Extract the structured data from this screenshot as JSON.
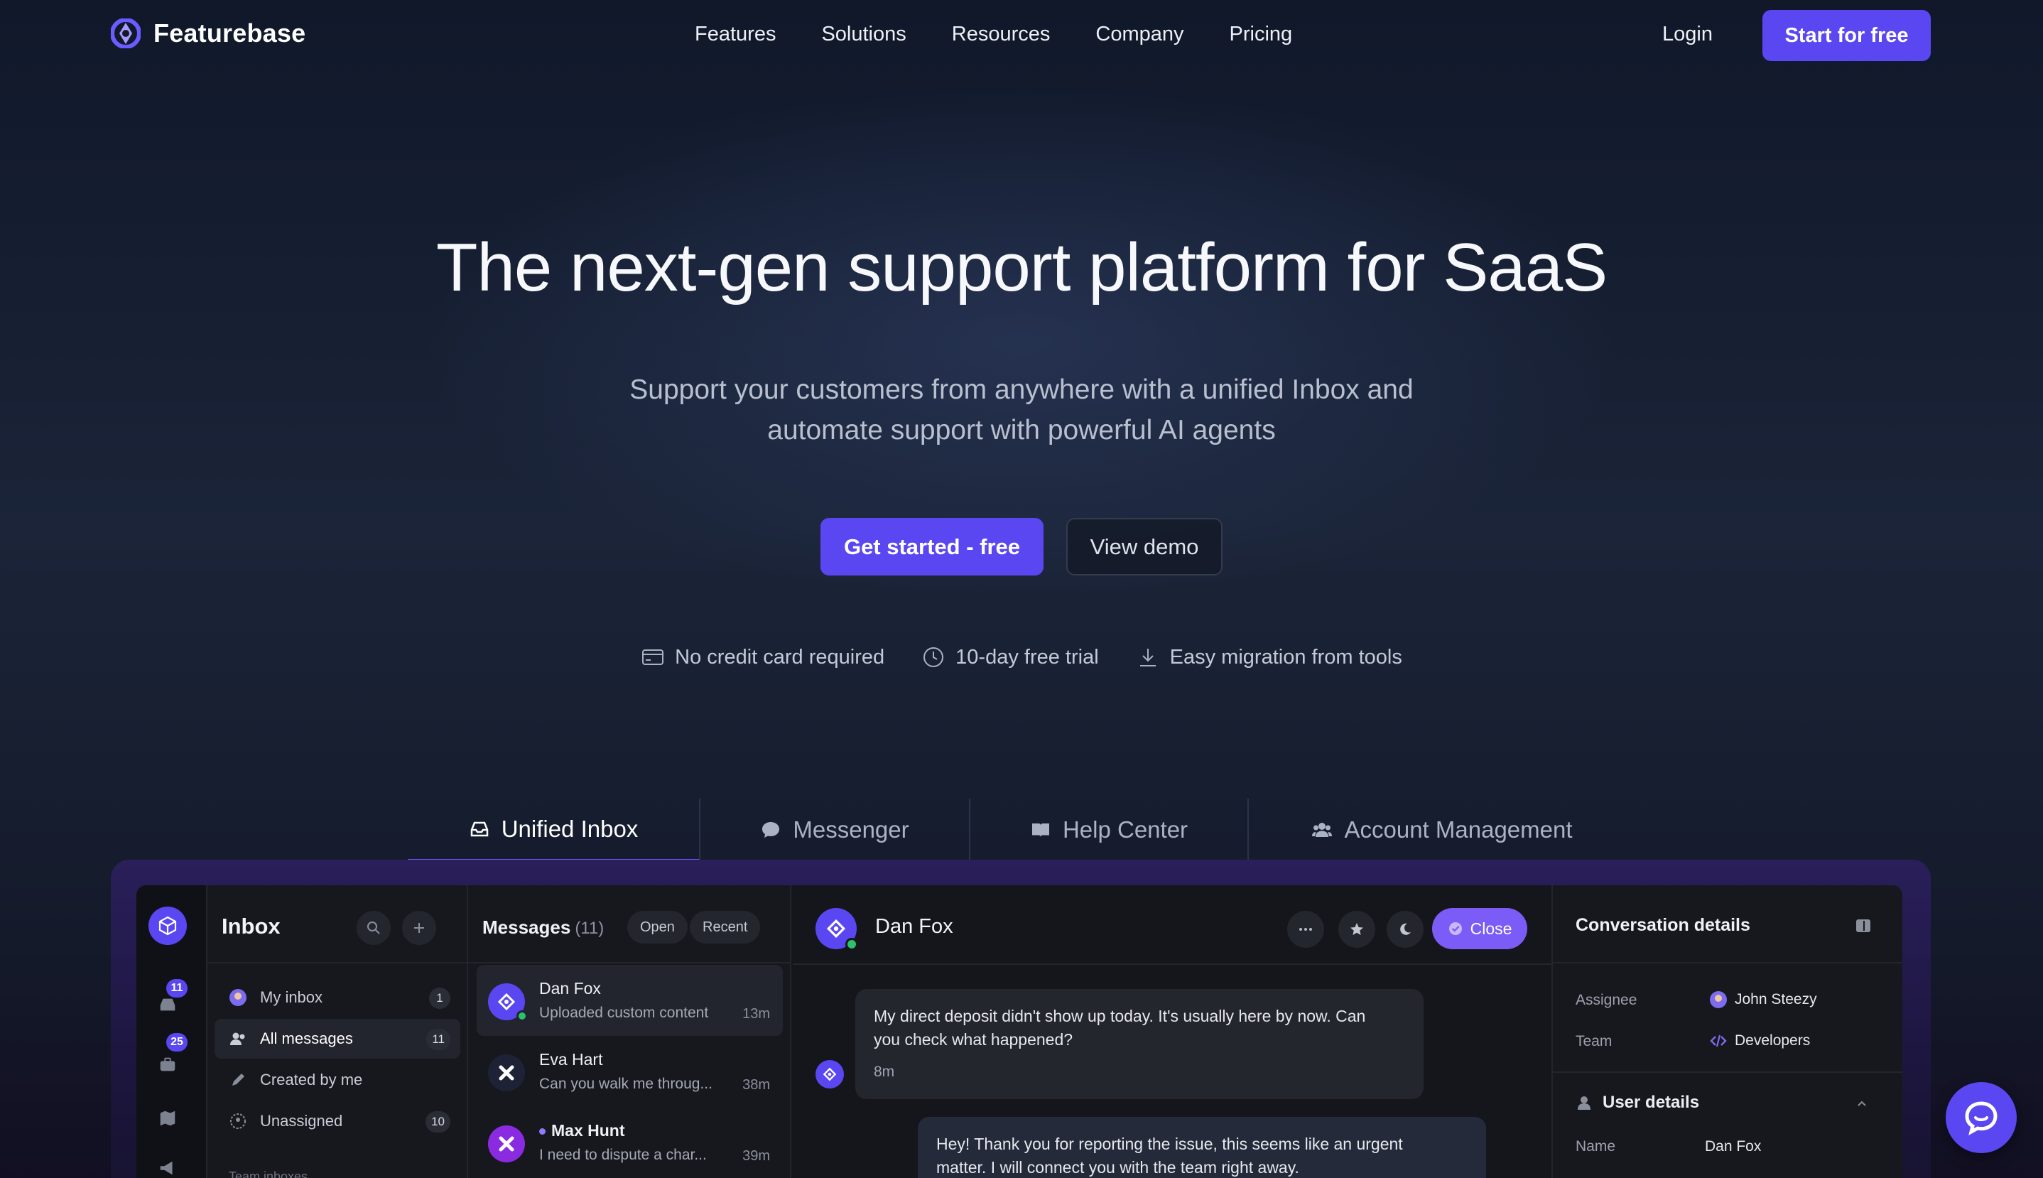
{
  "nav": {
    "brand": "Featurebase",
    "links": [
      "Features",
      "Solutions",
      "Resources",
      "Company",
      "Pricing"
    ],
    "login": "Login",
    "cta": "Start for free"
  },
  "hero": {
    "title": "The next-gen support platform for SaaS",
    "subtitle_line1": "Support your customers from anywhere with a unified Inbox and",
    "subtitle_line2": "automate support with powerful AI agents",
    "primary_cta": "Get started - free",
    "secondary_cta": "View demo",
    "perks": [
      "No credit card required",
      "10-day free trial",
      "Easy migration from tools"
    ]
  },
  "tabs": [
    {
      "label": "Unified Inbox",
      "icon": "inbox-icon",
      "active": true
    },
    {
      "label": "Messenger",
      "icon": "chat-icon",
      "active": false
    },
    {
      "label": "Help Center",
      "icon": "book-icon",
      "active": false
    },
    {
      "label": "Account Management",
      "icon": "users-icon",
      "active": false
    }
  ],
  "app": {
    "rail_badges": [
      "11",
      "25"
    ],
    "inbox": {
      "title": "Inbox",
      "items": [
        {
          "label": "My inbox",
          "count": "1",
          "active": false
        },
        {
          "label": "All messages",
          "count": "11",
          "active": true
        },
        {
          "label": "Created by me",
          "count": "",
          "active": false
        },
        {
          "label": "Unassigned",
          "count": "10",
          "active": false
        }
      ],
      "section": "Team inboxes"
    },
    "messages": {
      "title": "Messages",
      "count": "(11)",
      "filter_open": "Open",
      "filter_recent": "Recent",
      "rows": [
        {
          "name": "Dan Fox",
          "preview": "Uploaded custom content",
          "time": "13m",
          "active": true,
          "unread": false
        },
        {
          "name": "Eva Hart",
          "preview": "Can you walk me throug...",
          "time": "38m",
          "active": false,
          "unread": false
        },
        {
          "name": "Max Hunt",
          "preview": "I need to dispute a char...",
          "time": "39m",
          "active": false,
          "unread": true
        }
      ]
    },
    "chat": {
      "name": "Dan Fox",
      "close_label": "Close",
      "customer_message_line1": "My direct deposit didn't show up today. It's usually here by now. Can",
      "customer_message_line2": "you check what happened?",
      "customer_time": "8m",
      "agent_message_line1": "Hey! Thank you for reporting the issue, this seems like an urgent",
      "agent_message_line2": "matter. I will connect you with the team right away."
    },
    "details": {
      "title": "Conversation details",
      "assignee_label": "Assignee",
      "assignee_value": "John Steezy",
      "team_label": "Team",
      "team_value": "Developers",
      "user_section": "User details",
      "name_label": "Name",
      "name_value": "Dan Fox"
    }
  },
  "colors": {
    "accent": "#5a47f2",
    "close": "#7b5cf6",
    "online": "#2bc26b"
  }
}
